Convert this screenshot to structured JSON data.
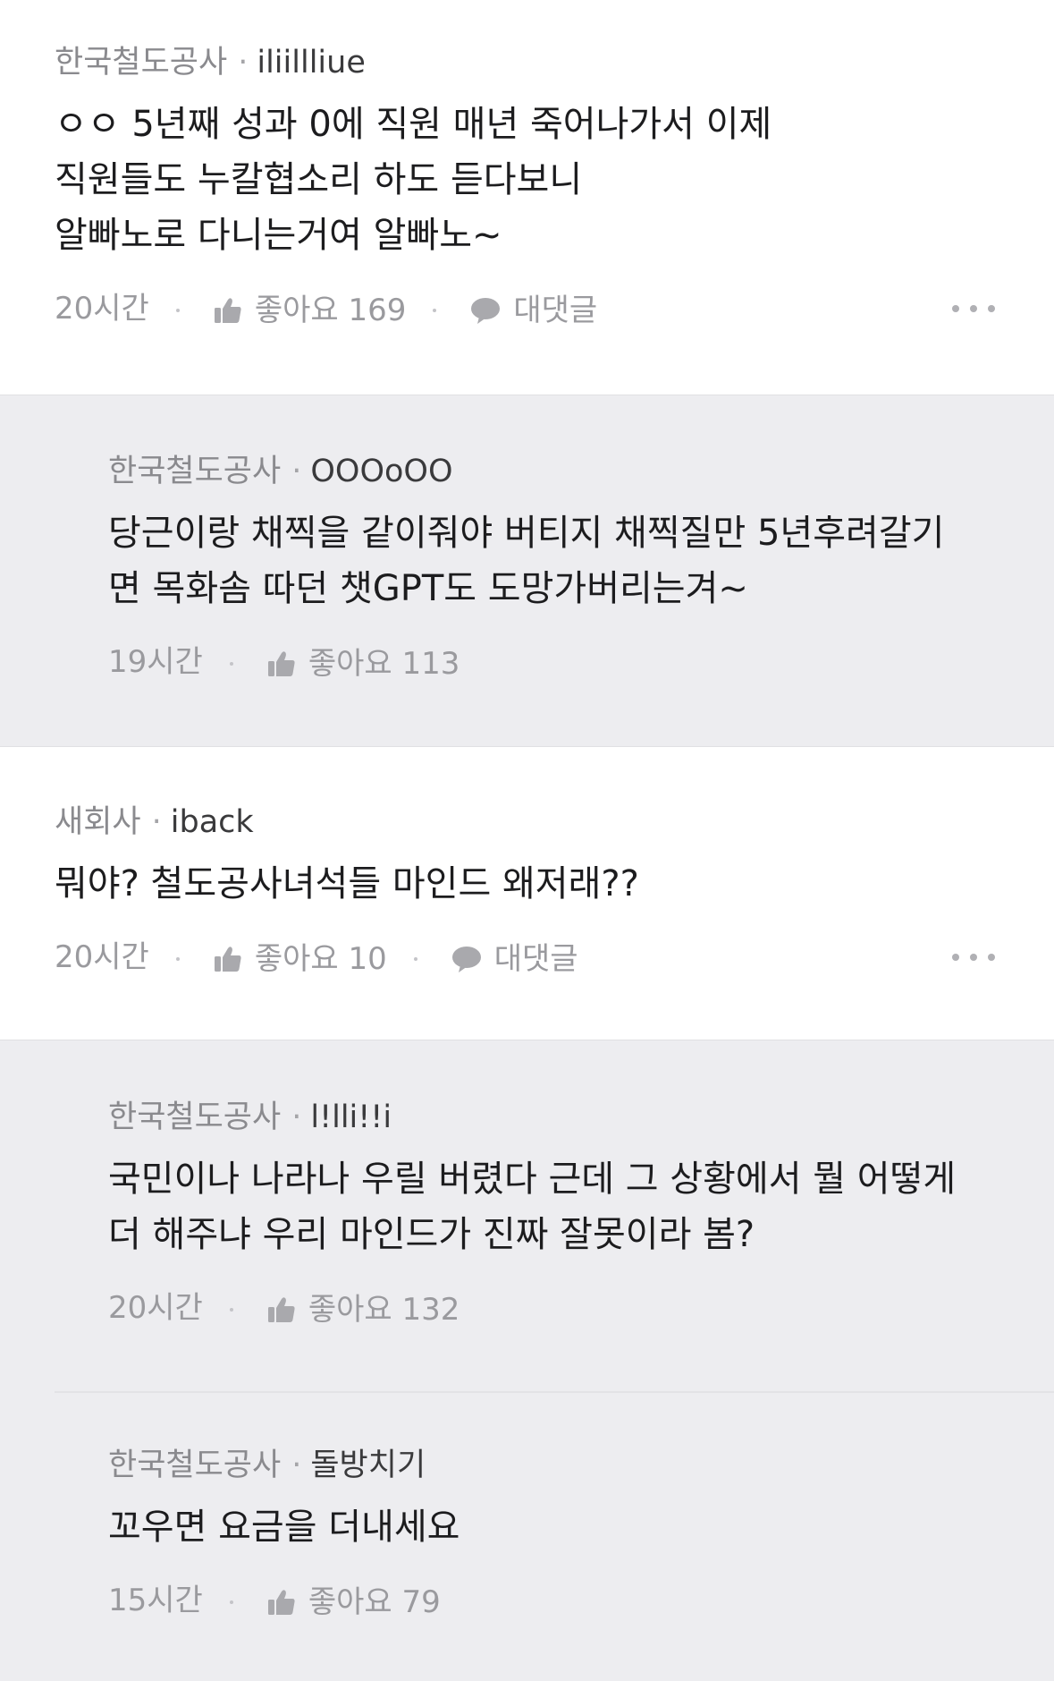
{
  "comments": [
    {
      "company": "한국철도공사",
      "handle": "iliillliue",
      "text": "ㅇㅇ 5년째 성과 0에 직원 매년 죽어나가서 이제\n직원들도 누칼협소리 하도 듣다보니\n알빠노로 다니는거여 알빠노~",
      "time": "20시간",
      "likes": "좋아요 169",
      "reply": "대댓글"
    },
    {
      "company": "한국철도공사",
      "handle": "OOOoOO",
      "text": "당근이랑 채찍을 같이줘야 버티지 채찍질만 5년후려갈기\n면 목화솜 따던 챗GPT도 도망가버리는겨~",
      "time": "19시간",
      "likes": "좋아요 113"
    },
    {
      "company": "새회사",
      "handle": "iback",
      "text": "뭐야? 철도공사녀석들 마인드 왜저래??",
      "time": "20시간",
      "likes": "좋아요 10",
      "reply": "대댓글"
    },
    {
      "company": "한국철도공사",
      "handle": "l!lli!!i",
      "text": "국민이나 나라나 우릴 버렸다 근데 그 상황에서 뭘 어떻게\n더 해주냐 우리 마인드가 진짜 잘못이라 봄?",
      "time": "20시간",
      "likes": "좋아요 132"
    },
    {
      "company": "한국철도공사",
      "handle": "돌방치기",
      "text": "꼬우면 요금을 더내세요",
      "time": "15시간",
      "likes": "좋아요 79"
    }
  ],
  "icons": {
    "like": "thumb-up-icon",
    "reply": "speech-bubble-icon",
    "more": "more-horizontal-icon"
  },
  "colors": {
    "reply_background": "#ededf0",
    "meta_text": "#8a8a8e"
  }
}
